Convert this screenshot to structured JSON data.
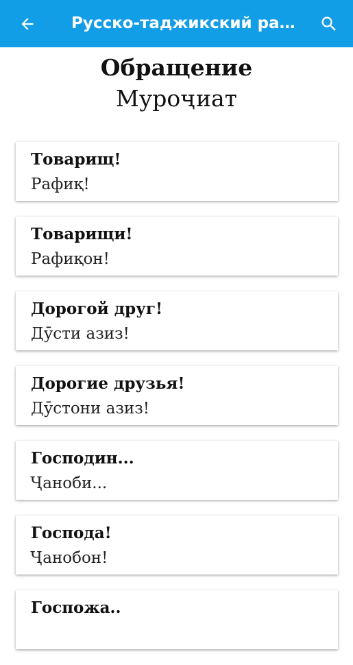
{
  "appbar": {
    "title": "Русско-таджикский ра…",
    "back_icon": "arrow-left-icon",
    "search_icon": "search-icon",
    "background_color": "#129de7"
  },
  "section": {
    "title_ru": "Обращение",
    "title_tj": "Муроҷиат"
  },
  "phrases": [
    {
      "ru": "Товарищ!",
      "tj": "Рафиқ!"
    },
    {
      "ru": "Товарищи!",
      "tj": "Рафиқон!"
    },
    {
      "ru": "Дорогой друг!",
      "tj": "Дӯсти азиз!"
    },
    {
      "ru": "Дорогие друзья!",
      "tj": "Дӯстони азиз!"
    },
    {
      "ru": "Господин...",
      "tj": "Ҷаноби..."
    },
    {
      "ru": "Господа!",
      "tj": "Ҷанобон!"
    },
    {
      "ru": "Госпожа..",
      "tj": ""
    }
  ]
}
